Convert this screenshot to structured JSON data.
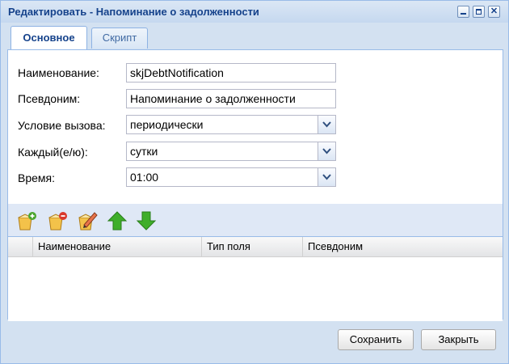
{
  "window": {
    "title": "Редактировать - Напоминание о задолженности"
  },
  "tabs": [
    {
      "label": "Основное",
      "active": true
    },
    {
      "label": "Скрипт",
      "active": false
    }
  ],
  "form": {
    "name": {
      "label": "Наименование:",
      "value": "skjDebtNotification"
    },
    "alias": {
      "label": "Псевдоним:",
      "value": "Напоминание о задолженности"
    },
    "condition": {
      "label": "Условие вызова:",
      "value": "периодически"
    },
    "every": {
      "label": "Каждый(е/ю):",
      "value": "сутки"
    },
    "time": {
      "label": "Время:",
      "value": "01:00"
    }
  },
  "toolbar": {
    "icons": [
      "add-field-icon",
      "delete-field-icon",
      "edit-field-icon",
      "move-up-icon",
      "move-down-icon"
    ]
  },
  "grid": {
    "columns": [
      "Наименование",
      "Тип поля",
      "Псевдоним"
    ],
    "rows": []
  },
  "footer": {
    "save_label": "Сохранить",
    "close_label": "Закрыть"
  },
  "colors": {
    "title": "#15428b",
    "frame": "#d3e1f1",
    "border": "#99bbe8",
    "arrow_green": "#3fae2a"
  }
}
